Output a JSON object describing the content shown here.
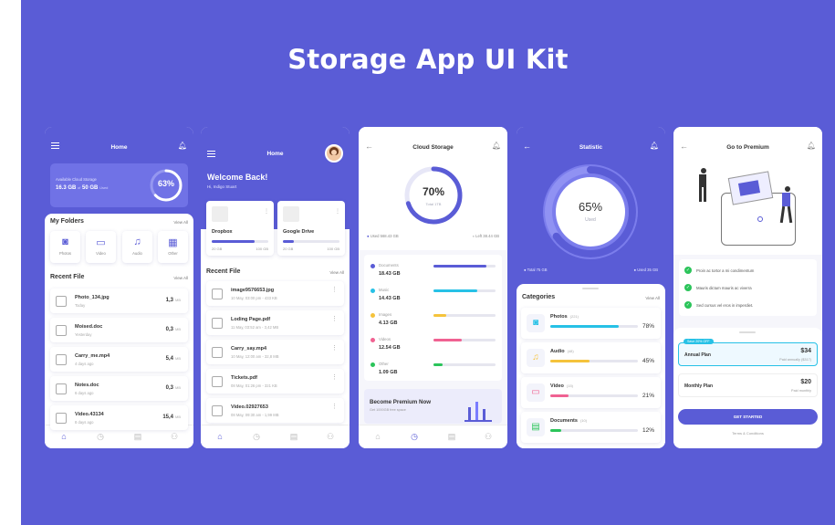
{
  "title": "Storage App UI Kit",
  "colors": {
    "primary": "#5a5cd6",
    "docs": "#5a5cd6",
    "music": "#27c1e6",
    "images": "#f5c33b",
    "videos": "#f06292",
    "other": "#2bc45a"
  },
  "s1": {
    "title": "Home",
    "cloud_label": "Available Cloud Storage",
    "used": "16.3 GB",
    "of": "of",
    "total": "50 GB",
    "used_label": "Used",
    "percent": "63%",
    "percent_value": 0.63,
    "folders_title": "My Folders",
    "view_all": "View All",
    "folders": [
      {
        "label": "Photos",
        "icon": "camera-icon"
      },
      {
        "label": "Video",
        "icon": "video-icon"
      },
      {
        "label": "Audio",
        "icon": "music-icon"
      },
      {
        "label": "Other",
        "icon": "grid-icon"
      }
    ],
    "recent_title": "Recent File",
    "files": [
      {
        "name": "Photo_134.jpg",
        "date": "Today",
        "size": "1,3",
        "unit": "MB"
      },
      {
        "name": "Moised.doc",
        "date": "Yesterday",
        "size": "0,3",
        "unit": "MB"
      },
      {
        "name": "Carry_me.mp4",
        "date": "4 days ago",
        "size": "5,4",
        "unit": "MB"
      },
      {
        "name": "Notes.doc",
        "date": "6 days ago",
        "size": "0,3",
        "unit": "MB"
      },
      {
        "name": "Video.43134",
        "date": "8 days ago",
        "size": "15,4",
        "unit": "MB"
      }
    ]
  },
  "s2": {
    "title": "Home",
    "welcome": "Welcome Back!",
    "user": "Hi, Indigo Stuart",
    "drives": [
      {
        "name": "Dropbox",
        "used": "20 GB",
        "total": "100 GB",
        "fill": 0.75
      },
      {
        "name": "Google Drive",
        "used": "20 GB",
        "total": "100 GB",
        "fill": 0.2
      }
    ],
    "recent_title": "Recent File",
    "view_all": "View All",
    "files": [
      {
        "name": "image9576653.jpg",
        "meta": "10 May, 03:00 pm - 433 KB"
      },
      {
        "name": "Loding Page.pdf",
        "meta": "11 May, 03:52 am - 3,42 MB"
      },
      {
        "name": "Carry_say.mp4",
        "meta": "10 May, 12:00 am - 32,8 MB"
      },
      {
        "name": "Tickets.pdf",
        "meta": "08 May, 01:26 pm - 321 KB"
      },
      {
        "name": "Video.02927653",
        "meta": "08 May, 09:30 am - 1,99 MB"
      }
    ]
  },
  "s3": {
    "title": "Cloud Storage",
    "percent": "70%",
    "percent_value": 0.7,
    "total_label": "Total 1TB",
    "used": "Used 568.43 GB",
    "left": "Left 38.44 GB",
    "cats": [
      {
        "name": "Documents",
        "size": "18.43 GB",
        "color": "#5a5cd6",
        "fill": 0.85
      },
      {
        "name": "Music",
        "size": "14.43 GB",
        "color": "#27c1e6",
        "fill": 0.7
      },
      {
        "name": "Images",
        "size": "4.13 GB",
        "color": "#f5c33b",
        "fill": 0.2
      },
      {
        "name": "Videos",
        "size": "12.54 GB",
        "color": "#f06292",
        "fill": 0.45
      },
      {
        "name": "Other",
        "size": "1.09 GB",
        "color": "#2bc45a",
        "fill": 0.15
      }
    ],
    "premium": "Become Premium Now",
    "premium_sub": "Get 1000GB free space"
  },
  "s4": {
    "title": "Statistic",
    "percent": "65%",
    "used_label": "Used",
    "percent_value": 0.65,
    "total": "Total 75 GB",
    "used": "Used 35 GB",
    "categories_title": "Categories",
    "view_all": "View All",
    "cats": [
      {
        "name": "Photos",
        "count": "(221)",
        "pct": "78%",
        "color": "#27c1e6",
        "fill": 0.78,
        "icon": "camera-icon"
      },
      {
        "name": "Audio",
        "count": "(48)",
        "pct": "45%",
        "color": "#f5c33b",
        "fill": 0.45,
        "icon": "music-icon"
      },
      {
        "name": "Video",
        "count": "(15)",
        "pct": "21%",
        "color": "#f06292",
        "fill": 0.21,
        "icon": "video-icon"
      },
      {
        "name": "Documents",
        "count": "(10)",
        "pct": "12%",
        "color": "#2bc45a",
        "fill": 0.12,
        "icon": "document-icon"
      }
    ]
  },
  "s5": {
    "title": "Go to Premium",
    "features": [
      "Proin ac tortor a mi condimentum",
      "Mauris dictum mauris ac viverra",
      "Sed cursus vel eros in imperdiet."
    ],
    "badge": "Save 20% OFF",
    "plans": [
      {
        "name": "Annual Plan",
        "price": "$34",
        "sub": "Paid annually ($317)"
      },
      {
        "name": "Monthly Plan",
        "price": "$20",
        "sub": "Paid monthly"
      }
    ],
    "cta": "GET STARTED",
    "terms": "Terms & Conditions"
  }
}
